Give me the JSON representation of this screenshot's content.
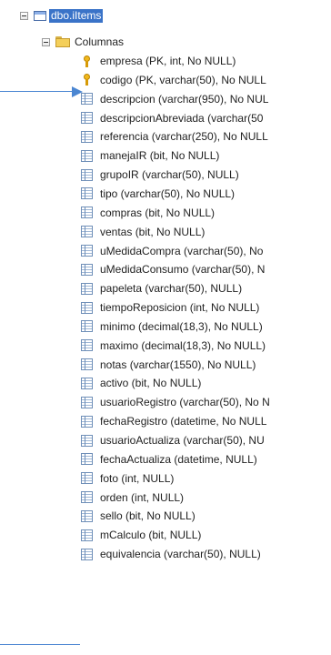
{
  "tree": {
    "table": {
      "label": "dbo.iItems"
    },
    "folder": {
      "label": "Columnas"
    },
    "columns": [
      {
        "label": "empresa (PK, int, No NULL)",
        "icon": "key-icon"
      },
      {
        "label": "codigo (PK, varchar(50), No NULL",
        "icon": "key-icon"
      },
      {
        "label": "descripcion (varchar(950), No NUL",
        "icon": "column-icon"
      },
      {
        "label": "descripcionAbreviada (varchar(50",
        "icon": "column-icon"
      },
      {
        "label": "referencia (varchar(250), No NULL",
        "icon": "column-icon"
      },
      {
        "label": "manejaIR (bit, No NULL)",
        "icon": "column-icon"
      },
      {
        "label": "grupoIR (varchar(50), NULL)",
        "icon": "column-icon"
      },
      {
        "label": "tipo (varchar(50), No NULL)",
        "icon": "column-icon"
      },
      {
        "label": "compras (bit, No NULL)",
        "icon": "column-icon"
      },
      {
        "label": "ventas (bit, No NULL)",
        "icon": "column-icon"
      },
      {
        "label": "uMedidaCompra (varchar(50), No",
        "icon": "column-icon"
      },
      {
        "label": "uMedidaConsumo (varchar(50), N",
        "icon": "column-icon"
      },
      {
        "label": "papeleta (varchar(50), NULL)",
        "icon": "column-icon"
      },
      {
        "label": "tiempoReposicion (int, No NULL)",
        "icon": "column-icon"
      },
      {
        "label": "minimo (decimal(18,3), No NULL)",
        "icon": "column-icon"
      },
      {
        "label": "maximo (decimal(18,3), No NULL)",
        "icon": "column-icon"
      },
      {
        "label": "notas (varchar(1550), No NULL)",
        "icon": "column-icon"
      },
      {
        "label": "activo (bit, No NULL)",
        "icon": "column-icon"
      },
      {
        "label": "usuarioRegistro (varchar(50), No N",
        "icon": "column-icon"
      },
      {
        "label": "fechaRegistro (datetime, No NULL",
        "icon": "column-icon"
      },
      {
        "label": "usuarioActualiza (varchar(50), NU",
        "icon": "column-icon"
      },
      {
        "label": "fechaActualiza (datetime, NULL)",
        "icon": "column-icon"
      },
      {
        "label": "foto (int, NULL)",
        "icon": "column-icon"
      },
      {
        "label": "orden (int, NULL)",
        "icon": "column-icon"
      },
      {
        "label": "sello (bit, No NULL)",
        "icon": "column-icon"
      },
      {
        "label": "mCalculo (bit, NULL)",
        "icon": "column-icon"
      },
      {
        "label": "equivalencia (varchar(50), NULL)",
        "icon": "column-icon"
      }
    ]
  },
  "colors": {
    "selection": "#3a73c8",
    "pointer": "#4b86d2",
    "text": "#1f1f1f"
  }
}
